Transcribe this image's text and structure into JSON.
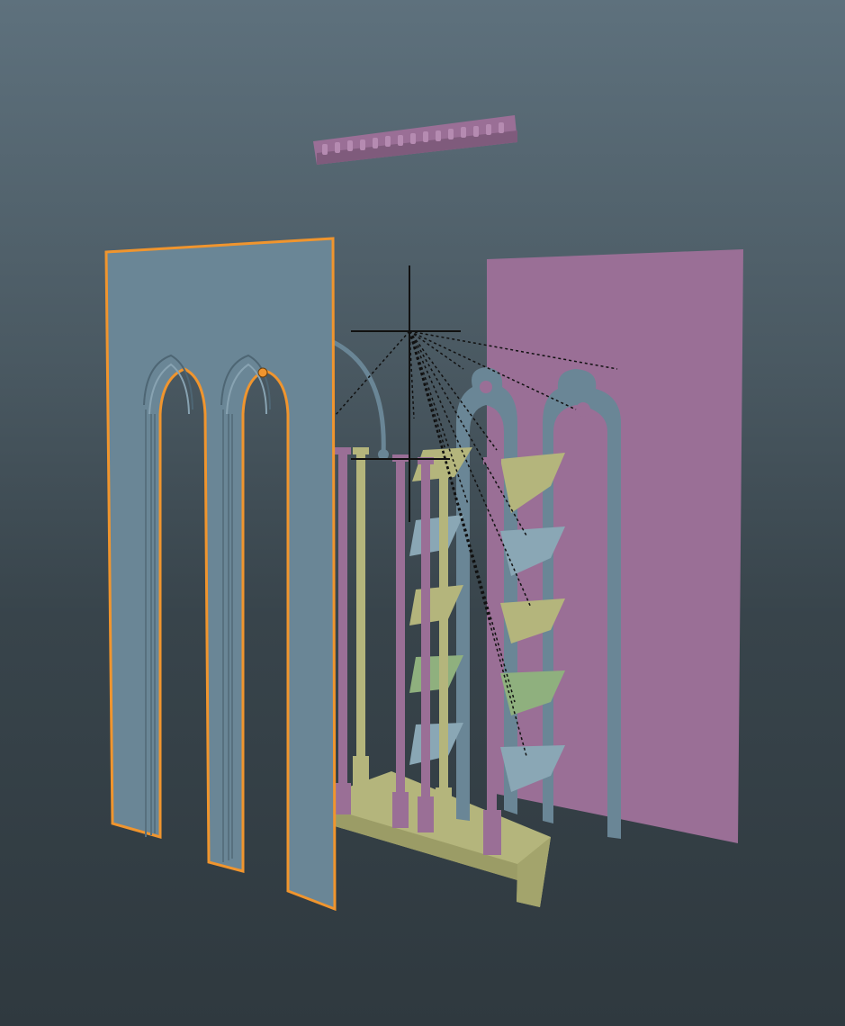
{
  "viewport": {
    "colors": {
      "background_top": "#5e717d",
      "background_bottom": "#2f393f",
      "selection_outline": "#f0952e",
      "mesh_blue": "#6a8696",
      "mesh_pink": "#9a6f96",
      "mesh_olive": "#b4b57c",
      "mesh_green": "#8fb07e",
      "pivot_line": "#111111"
    }
  },
  "scene": {
    "objects": [
      {
        "name": "cornice-trim",
        "color": "pink",
        "selected": false
      },
      {
        "name": "front-arched-wall-panel",
        "color": "blue",
        "selected": true
      },
      {
        "name": "back-wall-panel",
        "color": "pink",
        "selected": false
      },
      {
        "name": "trefoil-arch-frames",
        "color": "blue",
        "selected": false
      },
      {
        "name": "slender-columns",
        "color": "mixed",
        "selected": false
      },
      {
        "name": "tracery-shelf-tiles",
        "color": "mixed",
        "selected": false
      },
      {
        "name": "window-sill-base",
        "color": "olive",
        "selected": false
      }
    ]
  }
}
